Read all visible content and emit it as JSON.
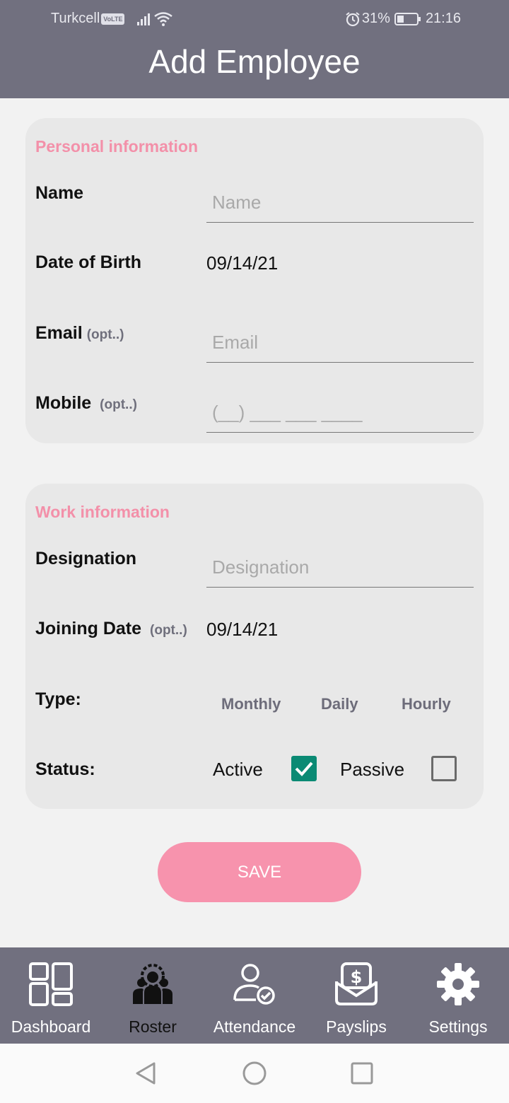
{
  "status_bar": {
    "carrier": "Turkcell",
    "volte": "VoLTE",
    "battery": "31%",
    "time": "21:16"
  },
  "header": {
    "title": "Add Employee"
  },
  "personal": {
    "section_title": "Personal information",
    "name_label": "Name",
    "name_placeholder": "Name",
    "dob_label": "Date of Birth",
    "dob_value": "09/14/21",
    "email_label": "Email",
    "email_opt": "(opt..)",
    "email_placeholder": "Email",
    "mobile_label": "Mobile",
    "mobile_opt": "(opt..)",
    "mobile_placeholder": "(__) ___ ___ ____"
  },
  "work": {
    "section_title": "Work information",
    "designation_label": "Designation",
    "designation_placeholder": "Designation",
    "joining_label": "Joining Date",
    "joining_opt": "(opt..)",
    "joining_value": "09/14/21",
    "type_label": "Type:",
    "type_options": [
      "Monthly",
      "Daily",
      "Hourly"
    ],
    "status_label": "Status:",
    "status_active": "Active",
    "status_passive": "Passive",
    "active_checked": true,
    "passive_checked": false
  },
  "save_label": "SAVE",
  "nav": {
    "items": [
      {
        "label": "Dashboard",
        "icon": "dashboard-grid-icon"
      },
      {
        "label": "Roster",
        "icon": "roster-team-icon",
        "active": true
      },
      {
        "label": "Attendance",
        "icon": "attendance-user-check-icon"
      },
      {
        "label": "Payslips",
        "icon": "payslips-envelope-dollar-icon"
      },
      {
        "label": "Settings",
        "icon": "settings-gear-icon"
      }
    ]
  },
  "colors": {
    "header_bg": "#71707f",
    "accent_pink": "#f390a9",
    "checkbox_green": "#0b8a74",
    "card_bg": "#e8e8e8"
  }
}
